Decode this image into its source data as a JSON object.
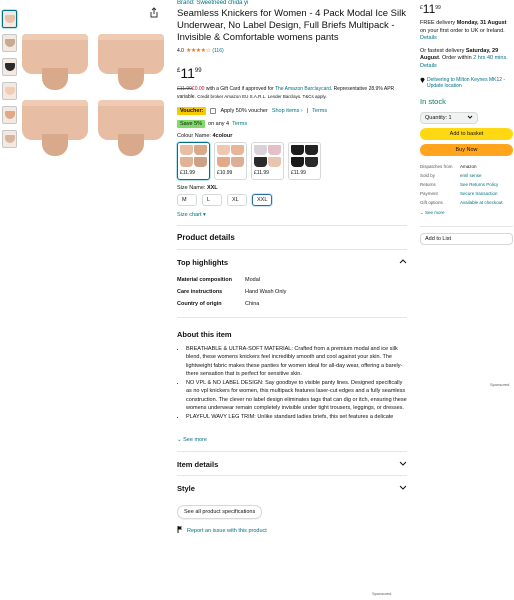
{
  "thumbnails": [
    {
      "name": "thumb-1"
    },
    {
      "name": "thumb-2"
    },
    {
      "name": "thumb-3"
    },
    {
      "name": "thumb-4"
    },
    {
      "name": "thumb-5"
    },
    {
      "name": "thumb-6"
    }
  ],
  "product": {
    "brand": "Brand: Sweetneed chida yi",
    "title": "Seamless Knickers for Women - 4 Pack Modal Ice Silk Underwear, No Label Design, Full Briefs Multipack - Invisible & Comfortable womens pants",
    "rating": "4.0",
    "stars": "★★★★☆",
    "review_count": "(116)"
  },
  "price": {
    "currency": "£",
    "whole": "11",
    "fraction": "99"
  },
  "credit": {
    "old_price": "£11.99",
    "new_price": "£0.00",
    "text1": " with a Gift Card if approved for ",
    "card_link": "The Amazon Barclaycard",
    "text2": ". Representative 28.9% APR variable. ",
    "small": "Credit broker Amazon EU S.A.R.L. Lender Barclays. T&Cs apply."
  },
  "voucher": {
    "tag": "Voucher:",
    "text": "Apply 50% voucher",
    "shop": "Shop items ›",
    "sep": "|",
    "terms": "Terms"
  },
  "save": {
    "tag": "Save 5%",
    "text": "on any 4",
    "terms": "Terms"
  },
  "colour": {
    "label": "Colour Name:",
    "value": "4colour",
    "swatches": [
      {
        "price": "£11.99",
        "selected": true
      },
      {
        "price": "£10.99",
        "selected": false
      },
      {
        "price": "£11.99",
        "selected": false
      },
      {
        "price": "£11.99",
        "selected": false
      }
    ]
  },
  "size": {
    "label": "Size Name:",
    "value": "XXL",
    "options": [
      "M",
      "L",
      "XL",
      "XXL"
    ],
    "chart": "Size chart ▾"
  },
  "details": {
    "heading": "Product details",
    "highlights_heading": "Top highlights",
    "rows": [
      {
        "k": "Material composition",
        "v": "Modal"
      },
      {
        "k": "Care instructions",
        "v": "Hand Wash Only"
      },
      {
        "k": "Country of origin",
        "v": "China"
      }
    ]
  },
  "about": {
    "heading": "About this item",
    "bullets": [
      "BREATHABLE & ULTRA-SOFT MATERIAL: Crafted from a premium modal and ice silk blend, these womens knickers feel incredibly smooth and cool against your skin. The lightweight fabric makes these panties for women ideal for all-day wear, offering a barely-there sensation that is perfect for sensitive skin.",
      "NO VPL & NO LABEL DESIGN: Say goodbye to visible panty lines. Designed specifically as no vpl knickers for women, this multipack features laser-cut edges and a fully seamless construction. The clever no label design eliminates tags that can dig or itch, ensuring these womens underwear remain completely invisible under tight trousers, leggings, or dresses.",
      "PLAYFUL WAVY LEG TRIM: Unlike standard ladies briefs, this set features a delicate"
    ],
    "see_more": "See more"
  },
  "sections": {
    "item_details": "Item details",
    "style": "Style",
    "all_specs": "See all product specifications",
    "report": "Report an issue with this product"
  },
  "buybox": {
    "price_currency": "£",
    "price_whole": "11",
    "price_fraction": "99",
    "delivery_pre": "FREE delivery ",
    "delivery_date": "Monday, 31 August",
    "delivery_post": " on your first order to UK or Ireland. ",
    "details": "Details",
    "fastest_pre": "Or fastest delivery ",
    "fastest_date": "Saturday, 29 August",
    "fastest_post": ". Order within ",
    "fastest_time": "2 hrs 40 mins.",
    "fastest_details": "Details",
    "deliver_to": "Delivering to Milton Keynes MK12 - Update location",
    "stock": "In stock",
    "quantity": "Quantity: 1",
    "add_basket": "Add to basket",
    "buy_now": "Buy Now",
    "meta": [
      {
        "k": "Dispatches from",
        "v": "Amazon",
        "plain": true
      },
      {
        "k": "Sold by",
        "v": "emil sense",
        "plain": false
      },
      {
        "k": "Returns",
        "v": "See Returns Policy",
        "plain": false
      },
      {
        "k": "Payment",
        "v": "Secure transaction",
        "plain": false
      },
      {
        "k": "Gift options",
        "v": "Available at checkout",
        "plain": false
      }
    ],
    "see_more": "See more",
    "add_list": "Add to List"
  },
  "sponsored": "Sponsored"
}
